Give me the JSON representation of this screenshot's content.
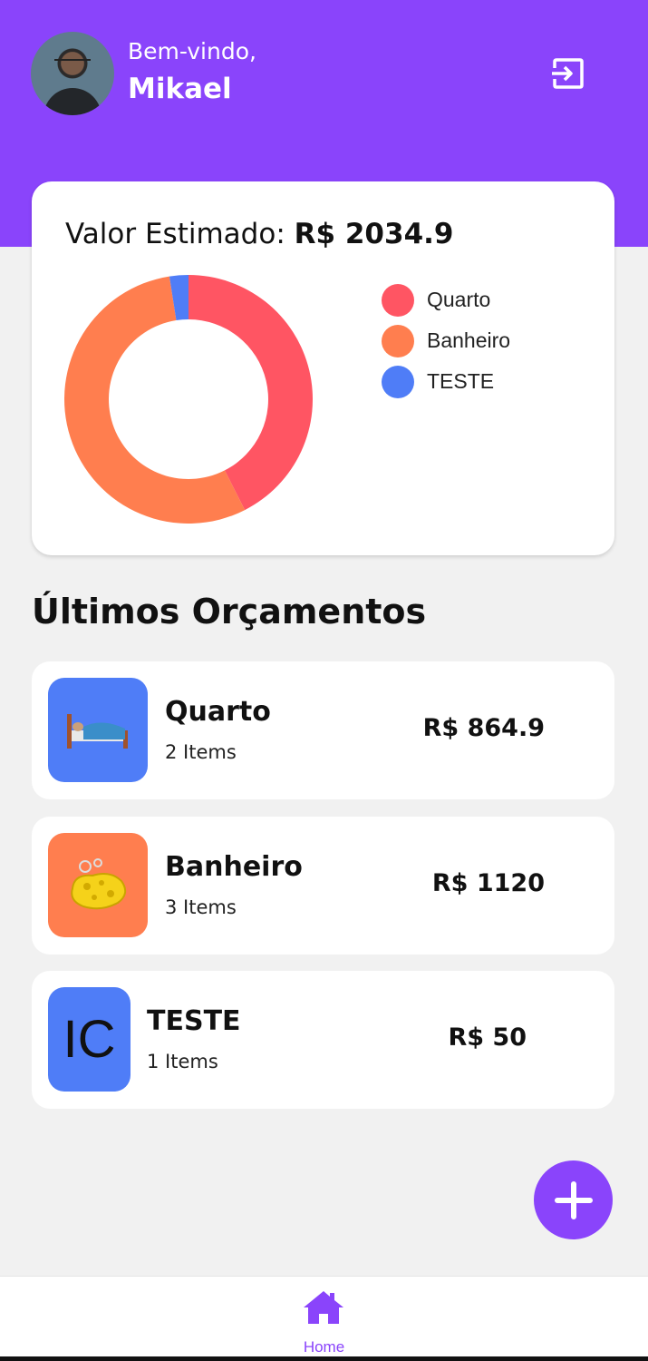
{
  "header": {
    "greeting": "Bem-vindo,",
    "username": "Mikael",
    "avatar_icon": "user-photo",
    "logout_icon": "logout-icon"
  },
  "summary": {
    "label": "Valor Estimado:",
    "total": "R$ 2034.9"
  },
  "chart_data": {
    "type": "pie",
    "title": "",
    "categories": [
      "Quarto",
      "Banheiro",
      "TESTE"
    ],
    "values": [
      864.9,
      1120,
      50
    ],
    "colors": [
      "#ff5563",
      "#ff7e4f",
      "#4f7df7"
    ],
    "legend_position": "right"
  },
  "section_title": "Últimos Orçamentos",
  "budgets": [
    {
      "name": "Quarto",
      "count": "2 Items",
      "price": "R$ 864.9",
      "icon": "bed-emoji",
      "icon_color": "#4f7df7"
    },
    {
      "name": "Banheiro",
      "count": "3 Items",
      "price": "R$ 1120",
      "icon": "sponge-emoji",
      "icon_color": "#ff7e4f"
    },
    {
      "name": "TESTE",
      "count": "1 Items",
      "price": "R$ 50",
      "icon_text": "IC",
      "icon_color": "#4f7df7"
    }
  ],
  "fab": {
    "icon": "plus-icon"
  },
  "nav": {
    "home_label": "Home",
    "home_icon": "home-icon"
  },
  "colors": {
    "primary": "#8a44fb",
    "background": "#f1f1f1"
  }
}
